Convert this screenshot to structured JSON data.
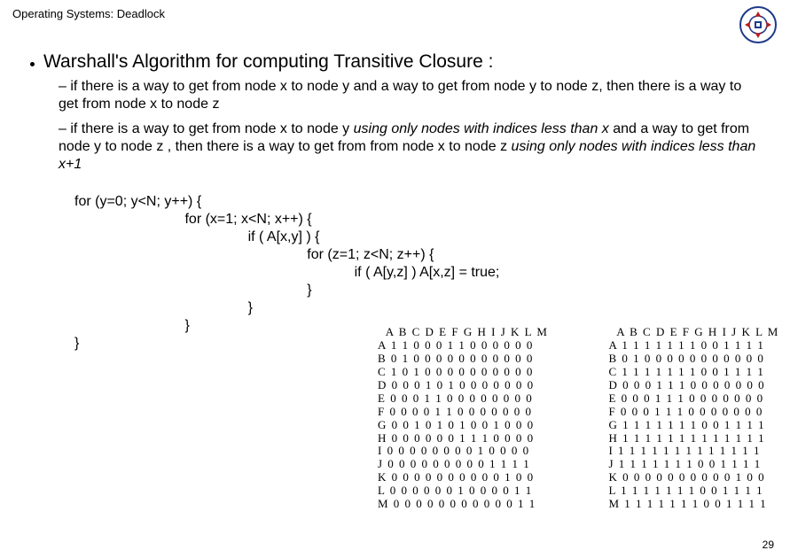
{
  "header": {
    "title": "Operating Systems: Deadlock"
  },
  "main": {
    "bullet": "Warshall's Algorithm for computing Transitive Closure :",
    "sub1_pre": "– if there is a way to get from node x to node y and a way to get from node y to node z, then there is a way to get from node x to node z",
    "sub2_a": "– if there is a way to get from node x to node y ",
    "sub2_b": "using only nodes with indices less than x",
    "sub2_c": " and a way to get from node y to node z , then there is a way to get from from node x to node z ",
    "sub2_d": "using only nodes with indices less than x+1"
  },
  "code": {
    "l1": "for (y=0; y<N; y++) {",
    "l2": "                            for (x=1; x<N; x++) {",
    "l3": "                                            if ( A[x,y] ) {",
    "l4": "                                                           for (z=1; z<N; z++) {",
    "l5": "                                                                       if ( A[y,z] ) A[x,z] = true;",
    "l6": "                                                           }",
    "l7": "                                            }",
    "l8": "                            }",
    "l9": "}"
  },
  "matrix_left": "  A B C D E F G H I J K L M\nA 1 1 0 0 0 1 1 0 0 0 0 0 0\nB 0 1 0 0 0 0 0 0 0 0 0 0 0\nC 1 0 1 0 0 0 0 0 0 0 0 0 0\nD 0 0 0 1 0 1 0 0 0 0 0 0 0\nE 0 0 0 1 1 0 0 0 0 0 0 0 0\nF 0 0 0 0 1 1 0 0 0 0 0 0 0\nG 0 0 1 0 1 0 1 0 0 1 0 0 0\nH 0 0 0 0 0 0 1 1 1 0 0 0 0\nI 0 0 0 0 0 0 0 0 1 0 0 0 0\nJ 0 0 0 0 0 0 0 0 0 1 1 1 1\nK 0 0 0 0 0 0 0 0 0 0 1 0 0\nL 0 0 0 0 0 0 1 0 0 0 0 1 1\nM 0 0 0 0 0 0 0 0 0 0 0 1 1",
  "matrix_right": "  A B C D E F G H I J K L M\nA 1 1 1 1 1 1 1 0 0 1 1 1 1\nB 0 1 0 0 0 0 0 0 0 0 0 0 0\nC 1 1 1 1 1 1 1 0 0 1 1 1 1\nD 0 0 0 1 1 1 0 0 0 0 0 0 0\nE 0 0 0 1 1 1 0 0 0 0 0 0 0\nF 0 0 0 1 1 1 0 0 0 0 0 0 0\nG 1 1 1 1 1 1 1 0 0 1 1 1 1\nH 1 1 1 1 1 1 1 1 1 1 1 1 1\nI 1 1 1 1 1 1 1 1 1 1 1 1 1\nJ 1 1 1 1 1 1 1 0 0 1 1 1 1\nK 0 0 0 0 0 0 0 0 0 0 1 0 0\nL 1 1 1 1 1 1 1 0 0 1 1 1 1\nM 1 1 1 1 1 1 1 0 0 1 1 1 1",
  "page_number": "29"
}
